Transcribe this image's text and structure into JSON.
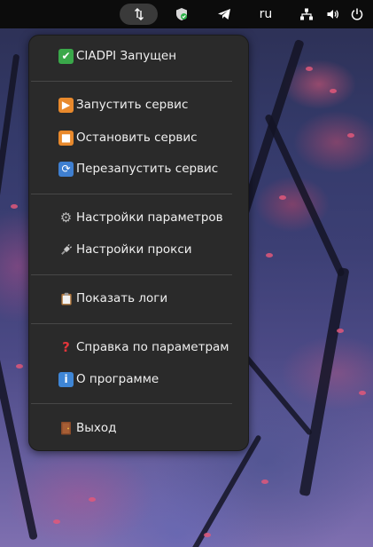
{
  "topbar": {
    "lang": "ru",
    "icons": [
      "ciadpi-tray-icon",
      "shield-icon",
      "telegram-icon",
      "network-icon",
      "volume-icon",
      "power-icon"
    ]
  },
  "menu": {
    "status": {
      "icon": "check-mark-icon",
      "label": "CIADPI Запущен"
    },
    "items": [
      {
        "icon": "play-icon",
        "label": "Запустить сервис"
      },
      {
        "icon": "stop-icon",
        "label": "Остановить сервис"
      },
      {
        "icon": "restart-icon",
        "label": "Перезапустить сервис"
      },
      {
        "icon": "gear-icon",
        "label": "Настройки параметров"
      },
      {
        "icon": "plug-icon",
        "label": "Настройки прокси"
      },
      {
        "icon": "clipboard-icon",
        "label": "Показать логи"
      },
      {
        "icon": "question-icon",
        "label": "Справка по параметрам"
      },
      {
        "icon": "info-icon",
        "label": "О программе"
      },
      {
        "icon": "door-icon",
        "label": "Выход"
      }
    ]
  },
  "colors": {
    "menu_bg": "#2a2a2a",
    "topbar_bg": "#0c0c0c",
    "separator": "#474747"
  }
}
